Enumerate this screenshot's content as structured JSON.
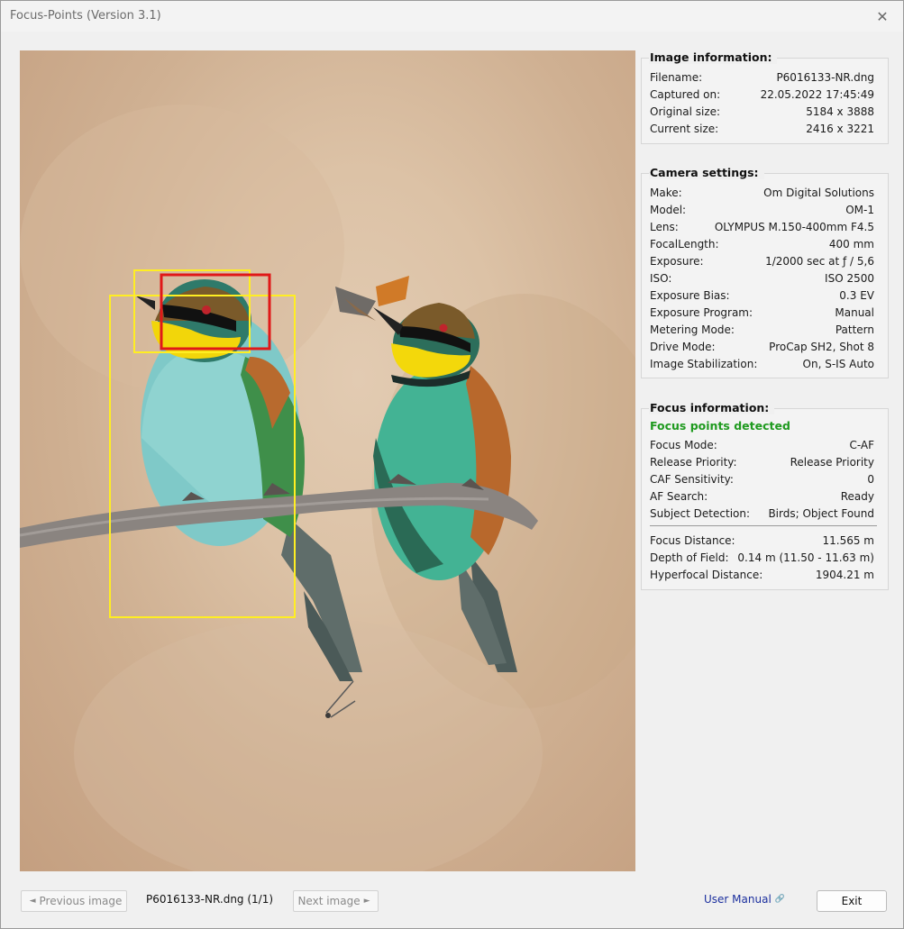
{
  "window": {
    "title": "Focus-Points (Version 3.1)",
    "close_glyph": "✕"
  },
  "image_info": {
    "title": "Image information:",
    "rows": [
      {
        "k": "Filename:",
        "v": "P6016133-NR.dng"
      },
      {
        "k": "Captured on:",
        "v": "22.05.2022 17:45:49"
      },
      {
        "k": "Original size:",
        "v": "5184 x 3888"
      },
      {
        "k": "Current size:",
        "v": "2416 x 3221"
      }
    ]
  },
  "camera": {
    "title": "Camera settings:",
    "rows": [
      {
        "k": "Make:",
        "v": "Om Digital Solutions"
      },
      {
        "k": "Model:",
        "v": "OM-1"
      },
      {
        "k": "Lens:",
        "v": "OLYMPUS M.150-400mm F4.5"
      },
      {
        "k": "FocalLength:",
        "v": "400 mm"
      },
      {
        "k": "Exposure:",
        "v": "1/2000 sec at ƒ / 5,6"
      },
      {
        "k": "ISO:",
        "v": "ISO 2500"
      },
      {
        "k": "Exposure Bias:",
        "v": "0.3 EV"
      },
      {
        "k": "Exposure Program:",
        "v": "Manual"
      },
      {
        "k": "Metering Mode:",
        "v": "Pattern"
      },
      {
        "k": "Drive Mode:",
        "v": "ProCap SH2, Shot 8"
      },
      {
        "k": "Image Stabilization:",
        "v": "On, S-IS Auto"
      }
    ]
  },
  "focus": {
    "title": "Focus information:",
    "status": "Focus points detected",
    "rows": [
      {
        "k": "Focus Mode:",
        "v": "C-AF"
      },
      {
        "k": "Release Priority:",
        "v": "Release Priority"
      },
      {
        "k": "CAF Sensitivity:",
        "v": "0"
      },
      {
        "k": "AF Search:",
        "v": "Ready"
      },
      {
        "k": "Subject Detection:",
        "v": "Birds; Object Found"
      }
    ],
    "rows2": [
      {
        "k": "Focus Distance:",
        "v": "11.565 m"
      },
      {
        "k": "Depth of Field:",
        "v": "0.14 m (11.50 - 11.63 m)"
      },
      {
        "k": "Hyperfocal Distance:",
        "v": "1904.21 m"
      }
    ]
  },
  "footer": {
    "prev_label": "Previous image",
    "prev_glyph": "◄",
    "next_label": "Next image",
    "next_glyph": "►",
    "file_status": "P6016133-NR.dng (1/1)",
    "manual_label": "User Manual",
    "manual_icon": "🔗",
    "exit_label": "Exit"
  },
  "colors": {
    "focus_box_primary": "#e01818",
    "focus_box_secondary": "#ffee22",
    "detected_text": "#1f9a1f",
    "link": "#1b2f9e"
  }
}
